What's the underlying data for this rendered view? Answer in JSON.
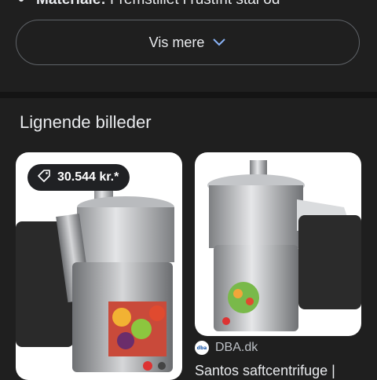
{
  "snippet": {
    "label": "Materiale:",
    "text": "Fremstillet i rustfrit stål od"
  },
  "show_more": {
    "label": "Vis mere",
    "icon": "chevron-down-icon"
  },
  "similar": {
    "title": "Lignende billeder",
    "items": [
      {
        "price": "30.544 kr.*",
        "price_icon": "tag-icon"
      },
      {
        "source": "DBA.dk",
        "favicon_text": "dba",
        "title": "Santos saftcentrifuge |"
      }
    ]
  },
  "colors": {
    "background": "#1f1f1f",
    "text": "#e8eaed",
    "border": "#5f6368",
    "badge": "#202124"
  }
}
